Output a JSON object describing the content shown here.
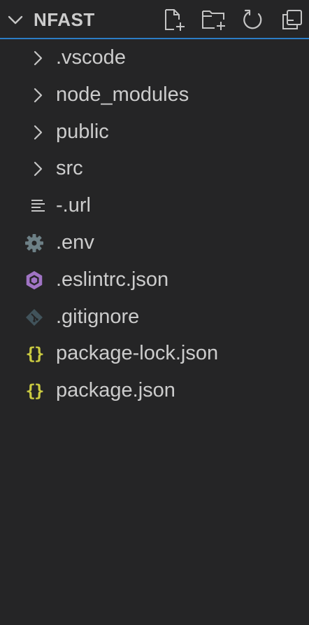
{
  "explorer": {
    "title": "NFAST",
    "actions": [
      "new-file",
      "new-folder",
      "refresh",
      "collapse-all"
    ]
  },
  "tree": [
    {
      "label": ".vscode",
      "kind": "folder",
      "icon": "chevron-right-icon"
    },
    {
      "label": "node_modules",
      "kind": "folder",
      "icon": "chevron-right-icon"
    },
    {
      "label": "public",
      "kind": "folder",
      "icon": "chevron-right-icon"
    },
    {
      "label": "src",
      "kind": "folder",
      "icon": "chevron-right-icon"
    },
    {
      "label": "-.url",
      "kind": "file",
      "icon": "text-lines-icon"
    },
    {
      "label": ".env",
      "kind": "file",
      "icon": "gear-icon"
    },
    {
      "label": ".eslintrc.json",
      "kind": "file",
      "icon": "eslint-icon"
    },
    {
      "label": ".gitignore",
      "kind": "file",
      "icon": "git-icon"
    },
    {
      "label": "package-lock.json",
      "kind": "file",
      "icon": "json-braces-icon"
    },
    {
      "label": "package.json",
      "kind": "file",
      "icon": "json-braces-icon"
    }
  ],
  "colors": {
    "background": "#252526",
    "text": "#cccccc",
    "focus_border": "#2c7dc6",
    "json_icon": "#cbcb41",
    "eslint_icon": "#a074c4",
    "gear_icon": "#6d8086"
  }
}
